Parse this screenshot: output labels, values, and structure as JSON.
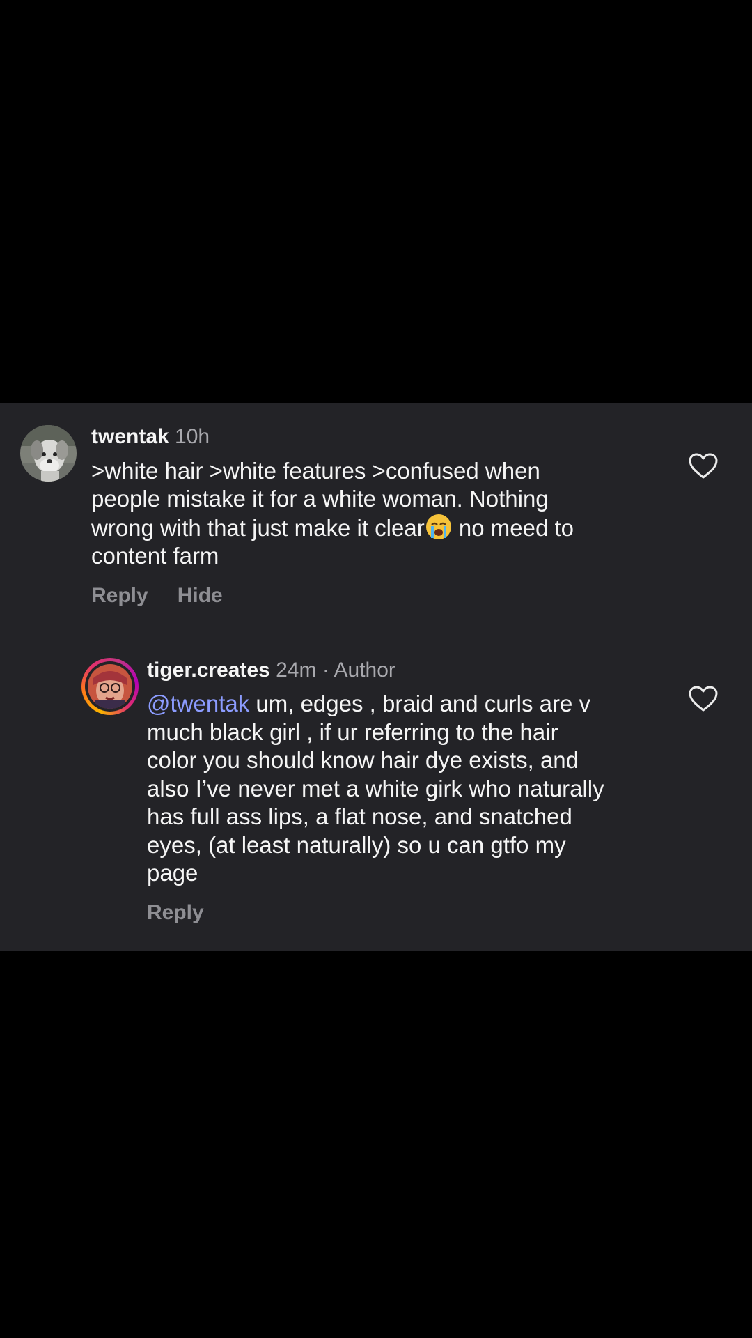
{
  "comments": [
    {
      "username": "twentak",
      "time": "10h",
      "body_lines": [
        ">white hair >white features >confused when",
        "people mistake it for a white woman. Nothing",
        "wrong with that just make it clear",
        " no meed to",
        "content farm"
      ],
      "emoji_icon": "loudly-crying-face-emoji",
      "reply_label": "Reply",
      "hide_label": "Hide",
      "liked": false
    },
    {
      "username": "tiger.creates",
      "time": "24m",
      "author_badge": "· Author",
      "mention": "@twentak",
      "body_lines": [
        " um, edges , braid and curls are v",
        "much black girl , if ur referring to the hair",
        "color you should know hair dye exists, and",
        "also I’ve never met a white girk who naturally",
        "has full ass lips, a flat nose, and snatched",
        "eyes, (at least naturally) so u can gtfo my",
        "page"
      ],
      "reply_label": "Reply",
      "liked": false
    }
  ],
  "colors": {
    "panel_background": "#232327",
    "primary_text": "#f5f5f5",
    "secondary_text": "#a8a8ad",
    "action_text": "#8e8e93",
    "mention": "#8c9cff"
  },
  "icons": [
    "heart-outline-icon",
    "avatar-dog-photo",
    "avatar-illustration-gradient-ring"
  ]
}
